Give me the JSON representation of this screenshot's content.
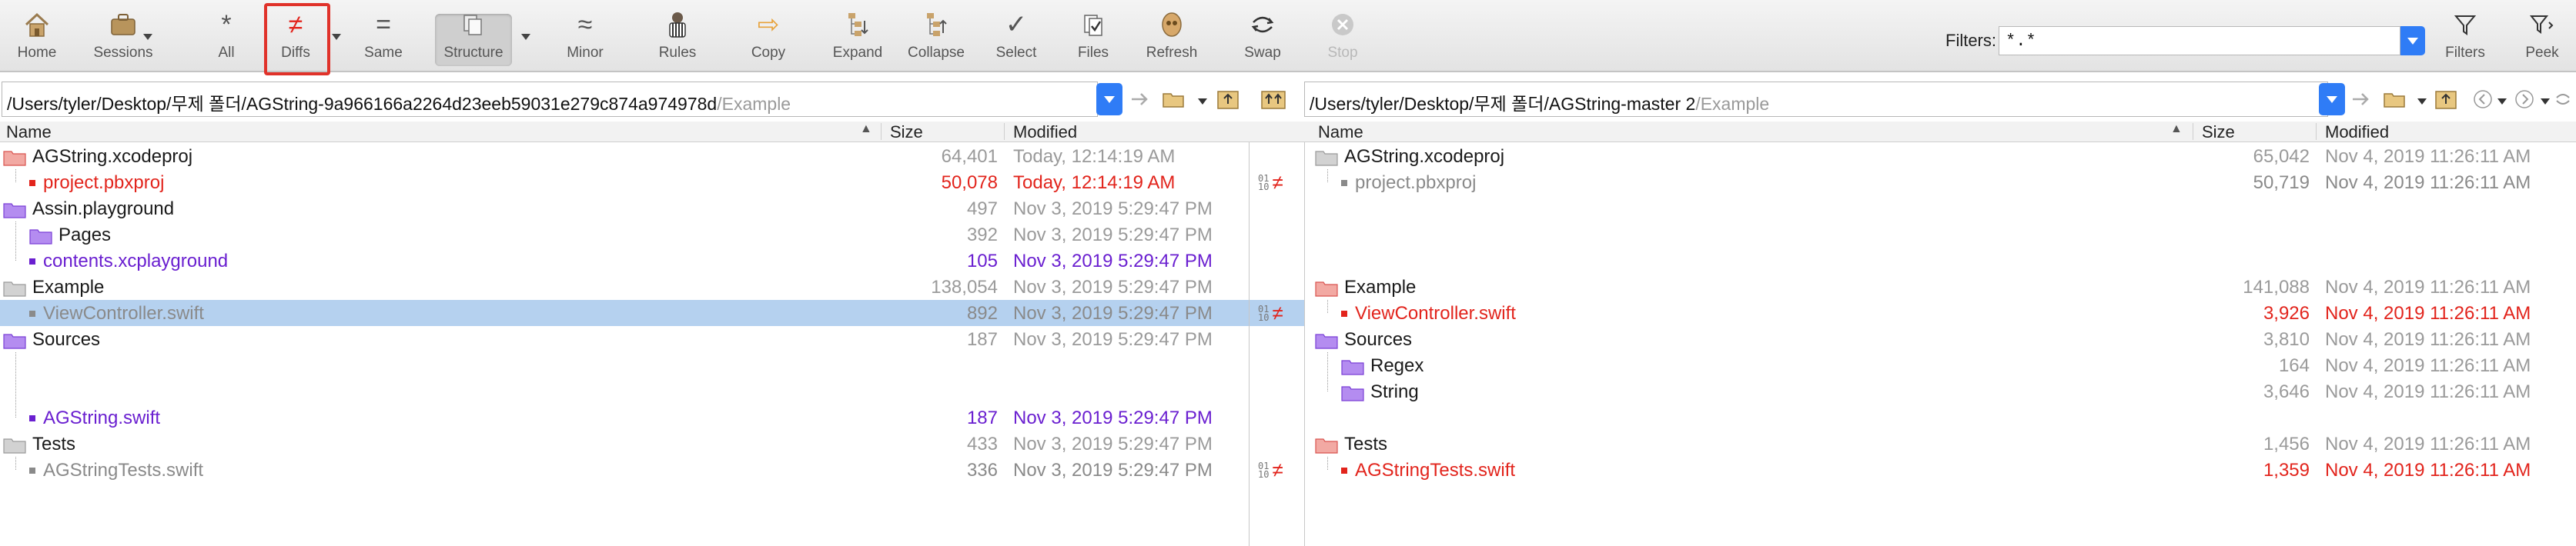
{
  "toolbar": {
    "buttons": [
      {
        "id": "home",
        "label": "Home",
        "icon": "home-icon"
      },
      {
        "id": "sessions",
        "label": "Sessions",
        "icon": "briefcase-icon"
      },
      {
        "id": "all",
        "label": "All",
        "icon": "asterisk-icon",
        "glyph": "*"
      },
      {
        "id": "diffs",
        "label": "Diffs",
        "icon": "not-equal-icon",
        "glyph": "≠"
      },
      {
        "id": "same",
        "label": "Same",
        "icon": "equal-icon",
        "glyph": "="
      },
      {
        "id": "structure",
        "label": "Structure",
        "icon": "structure-icon"
      },
      {
        "id": "minor",
        "label": "Minor",
        "icon": "approx-icon",
        "glyph": "≈"
      },
      {
        "id": "rules",
        "label": "Rules",
        "icon": "referee-icon"
      },
      {
        "id": "copy",
        "label": "Copy",
        "icon": "copy-arrow-icon",
        "glyph": "⇨"
      },
      {
        "id": "expand",
        "label": "Expand",
        "icon": "expand-tree-icon"
      },
      {
        "id": "collapse",
        "label": "Collapse",
        "icon": "collapse-tree-icon"
      },
      {
        "id": "select",
        "label": "Select",
        "icon": "checkmark-icon",
        "glyph": "✓"
      },
      {
        "id": "files",
        "label": "Files",
        "icon": "files-check-icon"
      },
      {
        "id": "refresh",
        "label": "Refresh",
        "icon": "refresh-icon"
      },
      {
        "id": "swap",
        "label": "Swap",
        "icon": "swap-icon"
      },
      {
        "id": "stop",
        "label": "Stop",
        "icon": "stop-icon",
        "glyph": "✕"
      }
    ],
    "filters_label": "Filters:",
    "filters_value": "*.*",
    "filters_button": "Filters",
    "peek_button": "Peek"
  },
  "left": {
    "path_main": "/Users/tyler/Desktop/무제 폴더/AGString-9a966166a2264d23eeb59031e279c874a974978d",
    "path_tail": "/Example",
    "headers": {
      "name": "Name",
      "size": "Size",
      "modified": "Modified"
    },
    "rows": [
      {
        "name": "AGString.xcodeproj",
        "size": "64,401",
        "modified": "Today, 12:14:19 AM"
      },
      {
        "name": "project.pbxproj",
        "size": "50,078",
        "modified": "Today, 12:14:19 AM"
      },
      {
        "name": "Assin.playground",
        "size": "497",
        "modified": "Nov 3, 2019 5:29:47 PM"
      },
      {
        "name": "Pages",
        "size": "392",
        "modified": "Nov 3, 2019 5:29:47 PM"
      },
      {
        "name": "contents.xcplayground",
        "size": "105",
        "modified": "Nov 3, 2019 5:29:47 PM"
      },
      {
        "name": "Example",
        "size": "138,054",
        "modified": "Nov 3, 2019 5:29:47 PM"
      },
      {
        "name": "ViewController.swift",
        "size": "892",
        "modified": "Nov 3, 2019 5:29:47 PM"
      },
      {
        "name": "Sources",
        "size": "187",
        "modified": "Nov 3, 2019 5:29:47 PM"
      },
      {
        "name": "AGString.swift",
        "size": "187",
        "modified": "Nov 3, 2019 5:29:47 PM"
      },
      {
        "name": "Tests",
        "size": "433",
        "modified": "Nov 3, 2019 5:29:47 PM"
      },
      {
        "name": "AGStringTests.swift",
        "size": "336",
        "modified": "Nov 3, 2019 5:29:47 PM"
      }
    ]
  },
  "right": {
    "path_main": "/Users/tyler/Desktop/무제 폴더/AGString-master 2",
    "path_tail": "/Example",
    "headers": {
      "name": "Name",
      "size": "Size",
      "modified": "Modified"
    },
    "rows": [
      {
        "name": "AGString.xcodeproj",
        "size": "65,042",
        "modified": "Nov 4, 2019 11:26:11 AM"
      },
      {
        "name": "project.pbxproj",
        "size": "50,719",
        "modified": "Nov 4, 2019 11:26:11 AM"
      },
      {
        "name": "Example",
        "size": "141,088",
        "modified": "Nov 4, 2019 11:26:11 AM"
      },
      {
        "name": "ViewController.swift",
        "size": "3,926",
        "modified": "Nov 4, 2019 11:26:11 AM"
      },
      {
        "name": "Sources",
        "size": "3,810",
        "modified": "Nov 4, 2019 11:26:11 AM"
      },
      {
        "name": "Regex",
        "size": "164",
        "modified": "Nov 4, 2019 11:26:11 AM"
      },
      {
        "name": "String",
        "size": "3,646",
        "modified": "Nov 4, 2019 11:26:11 AM"
      },
      {
        "name": "Tests",
        "size": "1,456",
        "modified": "Nov 4, 2019 11:26:11 AM"
      },
      {
        "name": "AGStringTests.swift",
        "size": "1,359",
        "modified": "Nov 4, 2019 11:26:11 AM"
      }
    ]
  },
  "center": {
    "diff_glyph": "≠",
    "marker_top": "01",
    "marker_bottom": "10"
  },
  "colors": {
    "different": "#e2241c",
    "orphan": "#6a1fd0",
    "same": "#8a8a8a",
    "selected_row": "#b5d1ef",
    "accent": "#2f7cf6",
    "highlight": "#e0322a"
  }
}
